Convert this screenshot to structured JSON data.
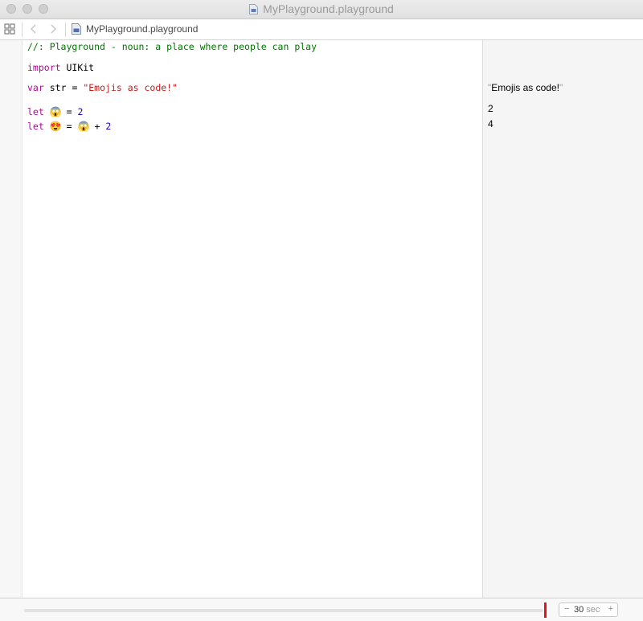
{
  "window": {
    "title": "MyPlayground.playground"
  },
  "jumpbar": {
    "file_label": "MyPlayground.playground"
  },
  "code": {
    "comment": "//: Playground - noun: a place where people can play",
    "import_kw": "import",
    "import_module": "UIKit",
    "var_kw": "var",
    "var_name": "str",
    "equals": "=",
    "var_value": "\"Emojis as code!\"",
    "let_kw": "let",
    "emoji_scream": "😱",
    "emoji_heart_eyes": "😍",
    "num_2": "2",
    "plus": "+"
  },
  "results": {
    "str_value": "Emojis as code!",
    "scream_value": "2",
    "heart_value": "4"
  },
  "timeline": {
    "duration_value": "30",
    "duration_unit": "sec",
    "decrement": "−",
    "increment": "+",
    "progress": 1.0
  },
  "colors": {
    "keyword": "#aa0d91",
    "comment": "#007400",
    "string": "#c41a16",
    "number": "#1c00cf",
    "playhead": "#e8121b"
  }
}
